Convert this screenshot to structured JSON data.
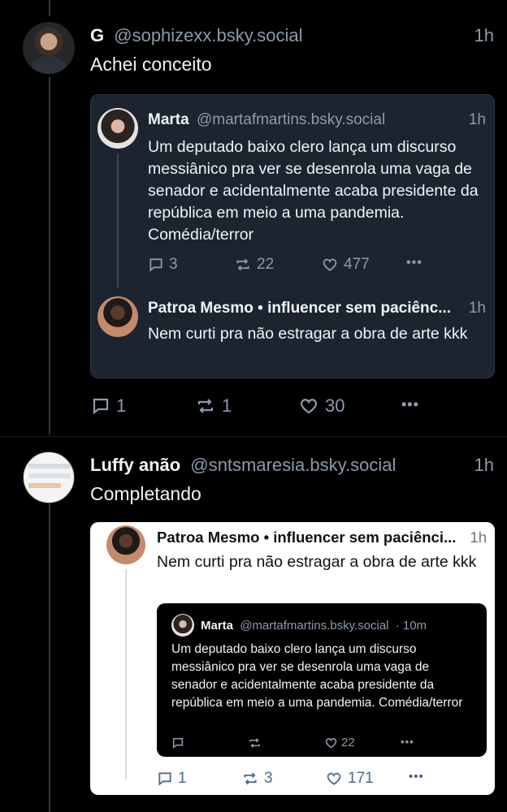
{
  "post1": {
    "author_name": "G",
    "handle": "@sophizexx.bsky.social",
    "time": "1h",
    "text": "Achei conceito",
    "quote": {
      "marta": {
        "name": "Marta",
        "handle": "@martafmartins.bsky.social",
        "time": "1h",
        "text": "Um deputado baixo clero lança um discurso messiânico pra ver se desenrola uma vaga de senador e acidentalmente acaba presidente da república em meio a uma pandemia. Comédia/terror",
        "replies": "3",
        "reposts": "22",
        "likes": "477"
      },
      "patroa": {
        "header": "Patroa Mesmo • influencer sem paciênc...",
        "time": "1h",
        "text": "Nem curti pra não estragar a obra de arte kkk"
      }
    },
    "replies": "1",
    "reposts": "1",
    "likes": "30"
  },
  "post2": {
    "author_name": "Luffy anão",
    "handle": "@sntsmaresia.bsky.social",
    "time": "1h",
    "text": "Completando",
    "quote": {
      "patroa": {
        "header": "Patroa Mesmo • influencer sem paciênci...",
        "time": "1h",
        "text": "Nem curti pra não estragar a obra de arte kkk"
      },
      "inner": {
        "name": "Marta",
        "handle": "@martafmartins.bsky.social",
        "time": "· 10m",
        "text": "Um deputado baixo clero lança um discurso messiânico pra ver se desenrola uma vaga de senador e acidentalmente acaba presidente da república em meio a uma pandemia. Comédia/terror",
        "likes": "22"
      },
      "replies": "1",
      "reposts": "3",
      "likes": "171"
    }
  },
  "icons": {
    "more": "•••"
  },
  "colors": {
    "background": "#000000",
    "card_dark": "#1c2430",
    "card_light": "#ffffff",
    "muted": "#8d9aab",
    "text": "#f1f3f5"
  }
}
